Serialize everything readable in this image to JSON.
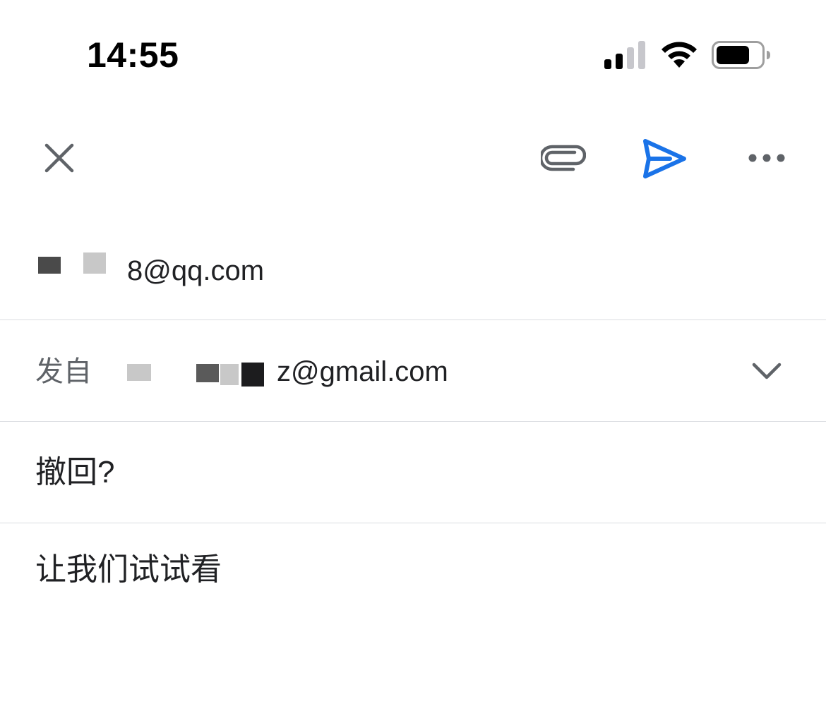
{
  "status_bar": {
    "time": "14:55",
    "signal_icon": "cellular-signal-icon",
    "wifi_icon": "wifi-icon",
    "battery_icon": "battery-icon"
  },
  "toolbar": {
    "close_icon": "close-icon",
    "attach_icon": "paperclip-icon",
    "send_icon": "send-icon",
    "more_icon": "more-horizontal-icon",
    "send_color": "#1a73e8",
    "icon_color": "#5f6368"
  },
  "compose": {
    "to_value_visible": "8@qq.com",
    "from_label": "发自",
    "from_value_visible": "z@gmail.com",
    "subject": "撤回?",
    "body": "让我们试试看"
  }
}
